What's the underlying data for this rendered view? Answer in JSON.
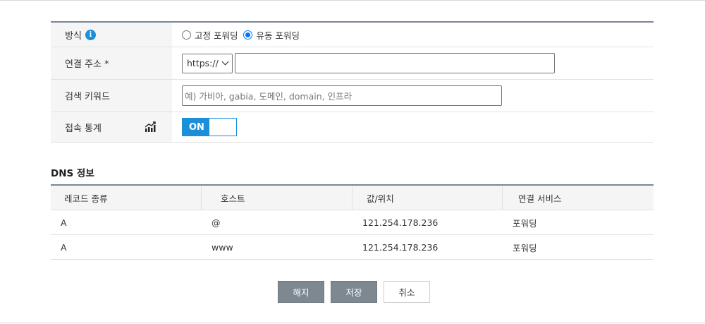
{
  "form": {
    "method": {
      "label": "방식",
      "info_icon": "info-icon",
      "options": [
        {
          "label": "고정 포워딩",
          "checked": false
        },
        {
          "label": "유동 포워딩",
          "checked": true
        }
      ]
    },
    "address": {
      "label": "연결 주소 *",
      "protocol_selected": "https://",
      "value": ""
    },
    "keyword": {
      "label": "검색 키워드",
      "placeholder": "예) 가비아, gabia, 도메인, domain, 인프라"
    },
    "stats": {
      "label": "접속 통계",
      "icon": "stats-chart-icon",
      "toggle_label": "ON",
      "toggle_state": "on"
    }
  },
  "dns": {
    "title": "DNS 정보",
    "columns": [
      "레코드 종류",
      "호스트",
      "값/위치",
      "연결 서비스"
    ],
    "rows": [
      [
        "A",
        "@",
        "121.254.178.236",
        "포워딩"
      ],
      [
        "A",
        "www",
        "121.254.178.236",
        "포워딩"
      ]
    ]
  },
  "buttons": {
    "cancel_forwarding": "해지",
    "save": "저장",
    "cancel": "취소"
  },
  "colors": {
    "accent": "#1b8fd9",
    "header_border": "#7a8696",
    "dark_button": "#7e8891"
  }
}
